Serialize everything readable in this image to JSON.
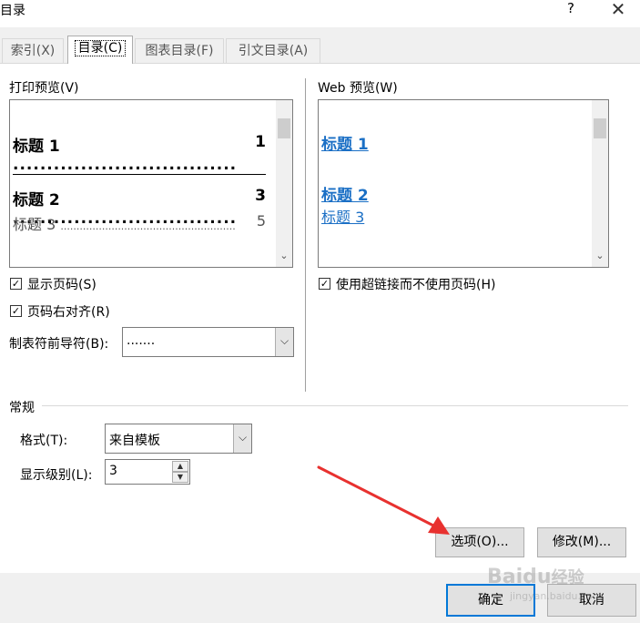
{
  "window": {
    "title": "目录",
    "help_icon": "?",
    "close_icon": "✕"
  },
  "tabs": [
    {
      "label": "索引(X)"
    },
    {
      "label": "目录(C)",
      "active": true
    },
    {
      "label": "图表目录(F)"
    },
    {
      "label": "引文目录(A)"
    }
  ],
  "print_preview": {
    "label": "打印预览(V)",
    "entries": [
      {
        "text": "标题 1",
        "dots": ".................................",
        "page": "1"
      },
      {
        "text": "标题 2",
        "dots": ".................................",
        "page": "3"
      },
      {
        "text": "标题 3",
        "dots": ".......................................................",
        "page": "5"
      }
    ]
  },
  "web_preview": {
    "label": "Web 预览(W)",
    "entries": [
      "标题 1",
      "标题 2",
      "标题 3"
    ]
  },
  "options": {
    "show_page_numbers": {
      "label": "显示页码(S)",
      "checked": true
    },
    "right_align": {
      "label": "页码右对齐(R)",
      "checked": true
    },
    "tab_leader": {
      "label": "制表符前导符(B):",
      "value": "......."
    },
    "use_hyperlinks": {
      "label": "使用超链接而不使用页码(H)",
      "checked": true
    }
  },
  "general": {
    "label": "常规",
    "format": {
      "label": "格式(T):",
      "value": "来自模板"
    },
    "levels": {
      "label": "显示级别(L):",
      "value": "3"
    }
  },
  "buttons": {
    "options": "选项(O)...",
    "modify": "修改(M)...",
    "ok": "确定",
    "cancel": "取消"
  },
  "glyphs": {
    "check": "✓",
    "down": "⌵",
    "up": "▲",
    "down_small": "▼",
    "scroll_down": "⌄"
  },
  "watermark": {
    "brand": "Baidu",
    "suffix": "经验",
    "url": "jingyan.baidu.com"
  },
  "colors": {
    "accent": "#0078d7",
    "link": "#1a6fc5",
    "annotation_arrow": "#e8312f"
  }
}
